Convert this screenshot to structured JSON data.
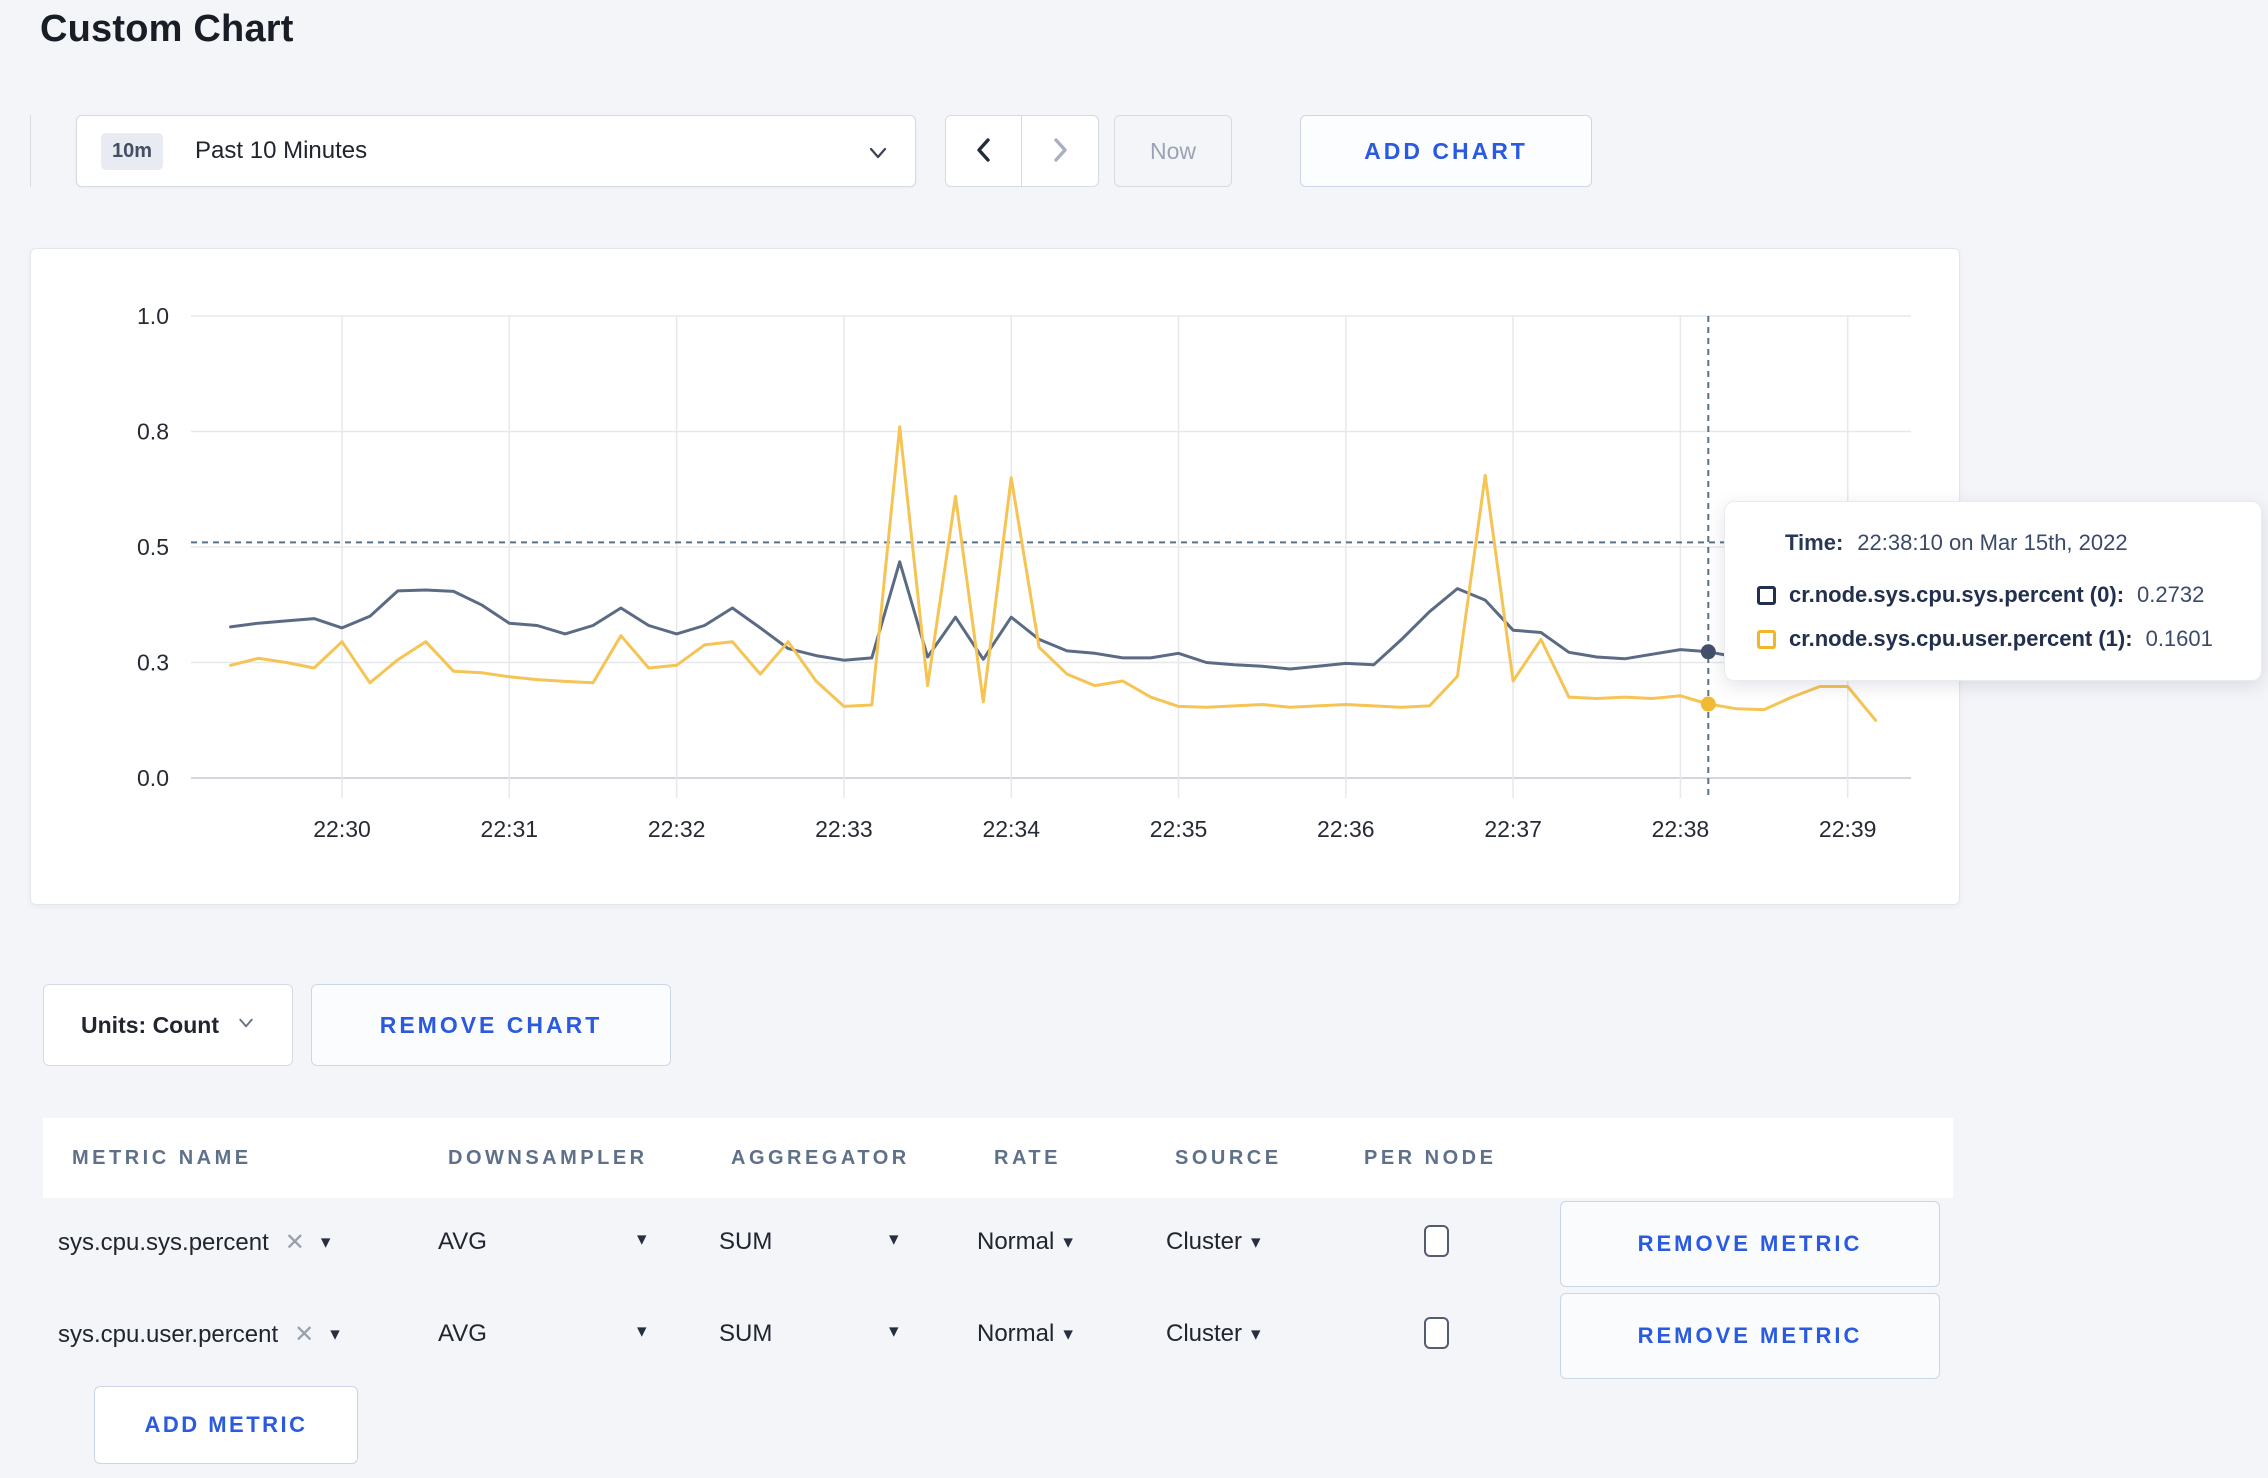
{
  "page": {
    "title": "Custom Chart",
    "background": "#f4f5f9"
  },
  "colors": {
    "accent_blue": "#2a5ae0",
    "series_sys": "#5b6b84",
    "series_user": "#f5c454",
    "crosshair": "#5b7186",
    "grid": "#e7e8ec"
  },
  "icons": {
    "close": "✕",
    "caret_down": "▾"
  },
  "toolbar": {
    "time_badge": "10m",
    "time_label": "Past 10 Minutes",
    "now_label": "Now",
    "add_chart_label": "ADD CHART"
  },
  "chart_data": {
    "type": "line",
    "title": "",
    "xlabel": "",
    "ylabel": "",
    "ylim": [
      0,
      1
    ],
    "grid": true,
    "y_ticks": [
      {
        "label": "1.0",
        "value": 1.0
      },
      {
        "label": "0.8",
        "value": 0.75
      },
      {
        "label": "0.5",
        "value": 0.5
      },
      {
        "label": "0.3",
        "value": 0.25
      },
      {
        "label": "0.0",
        "value": 0.0
      }
    ],
    "x_ticks": [
      "22:30",
      "22:31",
      "22:32",
      "22:33",
      "22:34",
      "22:35",
      "22:36",
      "22:37",
      "22:38",
      "22:39"
    ],
    "x": [
      "22:29:20",
      "22:29:30",
      "22:29:40",
      "22:29:50",
      "22:30:00",
      "22:30:10",
      "22:30:20",
      "22:30:30",
      "22:30:40",
      "22:30:50",
      "22:31:00",
      "22:31:10",
      "22:31:20",
      "22:31:30",
      "22:31:40",
      "22:31:50",
      "22:32:00",
      "22:32:10",
      "22:32:20",
      "22:32:30",
      "22:32:40",
      "22:32:50",
      "22:33:00",
      "22:33:10",
      "22:33:20",
      "22:33:30",
      "22:33:40",
      "22:33:50",
      "22:34:00",
      "22:34:10",
      "22:34:20",
      "22:34:30",
      "22:34:40",
      "22:34:50",
      "22:35:00",
      "22:35:10",
      "22:35:20",
      "22:35:30",
      "22:35:40",
      "22:35:50",
      "22:36:00",
      "22:36:10",
      "22:36:20",
      "22:36:30",
      "22:36:40",
      "22:36:50",
      "22:37:00",
      "22:37:10",
      "22:37:20",
      "22:37:30",
      "22:37:40",
      "22:37:50",
      "22:38:00",
      "22:38:10",
      "22:38:20",
      "22:38:30",
      "22:38:40",
      "22:38:50",
      "22:39:00",
      "22:39:10"
    ],
    "series": [
      {
        "name": "cr.node.sys.cpu.sys.percent (0)",
        "color": "#5b6b84",
        "marker_color": "#44506b",
        "values": [
          0.327,
          0.335,
          0.34,
          0.345,
          0.325,
          0.35,
          0.405,
          0.407,
          0.404,
          0.375,
          0.335,
          0.33,
          0.312,
          0.33,
          0.368,
          0.33,
          0.312,
          0.33,
          0.368,
          0.325,
          0.28,
          0.265,
          0.255,
          0.26,
          0.468,
          0.262,
          0.348,
          0.257,
          0.348,
          0.3,
          0.275,
          0.27,
          0.26,
          0.26,
          0.27,
          0.25,
          0.245,
          0.242,
          0.236,
          0.242,
          0.248,
          0.245,
          0.3,
          0.36,
          0.41,
          0.385,
          0.32,
          0.315,
          0.272,
          0.262,
          0.258,
          0.268,
          0.278,
          0.2732,
          0.262,
          0.278,
          0.285,
          0.272,
          0.268,
          0.27
        ]
      },
      {
        "name": "cr.node.sys.cpu.user.percent (1)",
        "color": "#f5c454",
        "marker_color": "#f1ba35",
        "values": [
          0.244,
          0.259,
          0.25,
          0.238,
          0.295,
          0.206,
          0.256,
          0.295,
          0.231,
          0.228,
          0.219,
          0.213,
          0.209,
          0.206,
          0.308,
          0.238,
          0.244,
          0.288,
          0.295,
          0.225,
          0.295,
          0.21,
          0.155,
          0.158,
          0.76,
          0.2,
          0.61,
          0.165,
          0.65,
          0.283,
          0.225,
          0.2,
          0.21,
          0.175,
          0.155,
          0.153,
          0.156,
          0.159,
          0.153,
          0.156,
          0.159,
          0.156,
          0.153,
          0.156,
          0.22,
          0.655,
          0.21,
          0.3,
          0.175,
          0.172,
          0.175,
          0.172,
          0.178,
          0.1601,
          0.15,
          0.148,
          0.175,
          0.198,
          0.198,
          0.125
        ]
      }
    ],
    "crosshair": {
      "time": "22:38:10",
      "hline": 0.51,
      "marker_values": [
        0.2732,
        0.1601
      ]
    },
    "legend_position": "tooltip"
  },
  "tooltip": {
    "time_label": "Time:",
    "time_value": "22:38:10 on Mar 15th, 2022",
    "rows": [
      {
        "name": "cr.node.sys.cpu.sys.percent (0):",
        "value": "0.2732",
        "color": "#22304e"
      },
      {
        "name": "cr.node.sys.cpu.user.percent (1):",
        "value": "0.1601",
        "color": "#f1b725"
      }
    ]
  },
  "chart_controls": {
    "units_label": "Units: Count",
    "remove_chart_label": "REMOVE CHART"
  },
  "metrics_table": {
    "headers": [
      "METRIC NAME",
      "DOWNSAMPLER",
      "AGGREGATOR",
      "RATE",
      "SOURCE",
      "PER NODE"
    ],
    "add_metric_label": "ADD METRIC",
    "rows": [
      {
        "metric_name": "sys.cpu.sys.percent",
        "downsampler": "AVG",
        "aggregator": "SUM",
        "rate": "Normal",
        "source": "Cluster",
        "per_node_checked": false,
        "remove_label": "REMOVE METRIC"
      },
      {
        "metric_name": "sys.cpu.user.percent",
        "downsampler": "AVG",
        "aggregator": "SUM",
        "rate": "Normal",
        "source": "Cluster",
        "per_node_checked": false,
        "remove_label": "REMOVE METRIC"
      }
    ]
  }
}
